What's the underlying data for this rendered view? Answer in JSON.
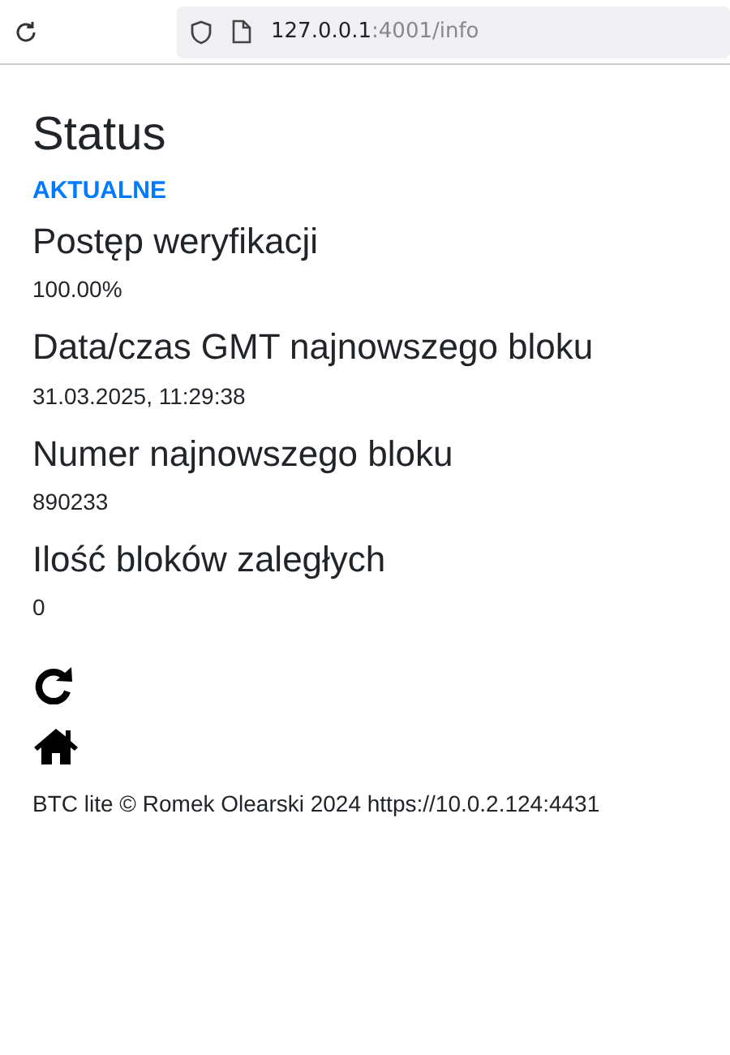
{
  "browser": {
    "url_host": "127.0.0.1",
    "url_path": ":4001/info"
  },
  "title": "Status",
  "status": "AKTUALNE",
  "fields": [
    {
      "label": "Postęp weryfikacji",
      "value": "100.00%"
    },
    {
      "label": "Data/czas GMT najnowszego bloku",
      "value": "31.03.2025, 11:29:38"
    },
    {
      "label": "Numer najnowszego bloku",
      "value": "890233"
    },
    {
      "label": "Ilość bloków zaległych",
      "value": "0"
    }
  ],
  "footer": "BTC lite © Romek Olearski 2024 https://10.0.2.124:4431"
}
